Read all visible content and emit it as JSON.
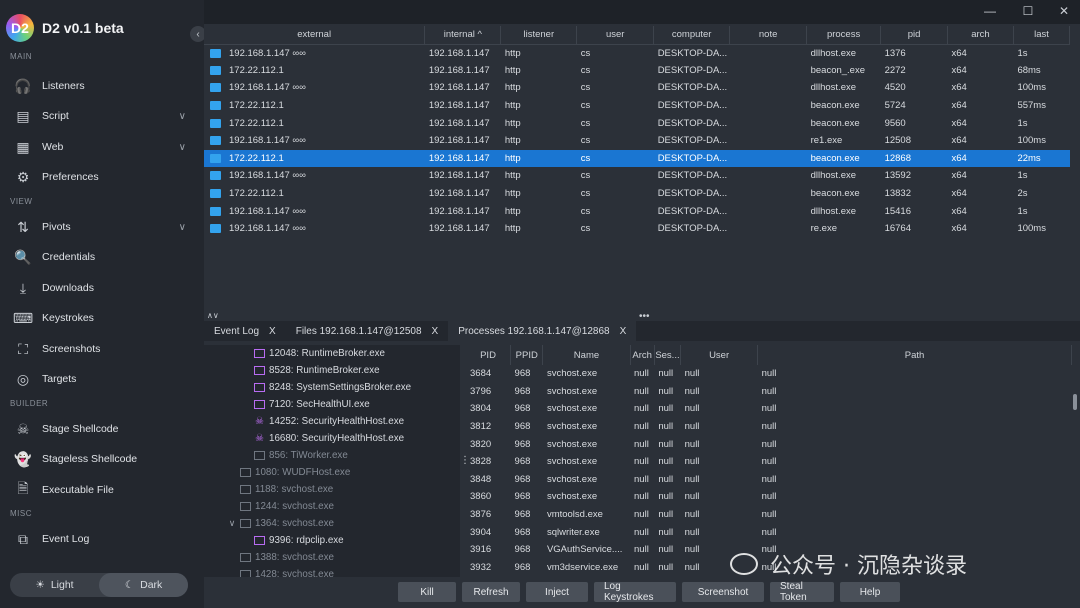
{
  "app": {
    "title": "D2 v0.1 beta",
    "logo_letter": "D2"
  },
  "window_controls": {
    "minimize": "—",
    "maximize": "☐",
    "close": "✕"
  },
  "sidebar": {
    "sections": [
      {
        "label": "MAIN",
        "items": [
          {
            "label": "Listeners",
            "icon": "headphones-icon",
            "glyph": "🎧"
          },
          {
            "label": "Script",
            "icon": "script-icon",
            "glyph": "▤",
            "chevron": true
          },
          {
            "label": "Web",
            "icon": "web-icon",
            "glyph": "▦",
            "chevron": true
          },
          {
            "label": "Preferences",
            "icon": "gear-icon",
            "glyph": "⚙"
          }
        ]
      },
      {
        "label": "VIEW",
        "items": [
          {
            "label": "Pivots",
            "icon": "pivot-icon",
            "glyph": "⇅",
            "chevron": true
          },
          {
            "label": "Credentials",
            "icon": "credentials-icon",
            "glyph": "🔍"
          },
          {
            "label": "Downloads",
            "icon": "download-icon",
            "glyph": "⤓"
          },
          {
            "label": "Keystrokes",
            "icon": "keyboard-icon",
            "glyph": "⌨"
          },
          {
            "label": "Screenshots",
            "icon": "screenshot-icon",
            "glyph": "⛶"
          },
          {
            "label": "Targets",
            "icon": "target-icon",
            "glyph": "◎"
          }
        ]
      },
      {
        "label": "BUILDER",
        "items": [
          {
            "label": "Stage Shellcode",
            "icon": "skull-icon",
            "glyph": "☠"
          },
          {
            "label": "Stageless Shellcode",
            "icon": "ghost-icon",
            "glyph": "👻"
          },
          {
            "label": "Executable File",
            "icon": "file-icon",
            "glyph": "🗎"
          }
        ]
      },
      {
        "label": "MISC",
        "items": [
          {
            "label": "Event Log",
            "icon": "event-log-icon",
            "glyph": "⧉"
          }
        ]
      }
    ],
    "theme": {
      "light": "Light",
      "dark": "Dark",
      "active": "Dark"
    }
  },
  "beacons": {
    "columns": [
      "external",
      "internal ^",
      "listener",
      "user",
      "computer",
      "note",
      "process",
      "pid",
      "arch",
      "last"
    ],
    "rows": [
      [
        "192.168.1.147 ∞∞",
        "192.168.1.147",
        "http",
        "cs",
        "DESKTOP-DA...",
        "",
        "dllhost.exe",
        "1376",
        "x64",
        "1s"
      ],
      [
        "172.22.112.1",
        "192.168.1.147",
        "http",
        "cs",
        "DESKTOP-DA...",
        "",
        "beacon_.exe",
        "2272",
        "x64",
        "68ms"
      ],
      [
        "192.168.1.147 ∞∞",
        "192.168.1.147",
        "http",
        "cs",
        "DESKTOP-DA...",
        "",
        "dllhost.exe",
        "4520",
        "x64",
        "100ms"
      ],
      [
        "172.22.112.1",
        "192.168.1.147",
        "http",
        "cs",
        "DESKTOP-DA...",
        "",
        "beacon.exe",
        "5724",
        "x64",
        "557ms"
      ],
      [
        "172.22.112.1",
        "192.168.1.147",
        "http",
        "cs",
        "DESKTOP-DA...",
        "",
        "beacon.exe",
        "9560",
        "x64",
        "1s"
      ],
      [
        "192.168.1.147 ∞∞",
        "192.168.1.147",
        "http",
        "cs",
        "DESKTOP-DA...",
        "",
        "re1.exe",
        "12508",
        "x64",
        "100ms"
      ],
      [
        "172.22.112.1",
        "192.168.1.147",
        "http",
        "cs",
        "DESKTOP-DA...",
        "",
        "beacon.exe",
        "12868",
        "x64",
        "22ms"
      ],
      [
        "192.168.1.147 ∞∞",
        "192.168.1.147",
        "http",
        "cs",
        "DESKTOP-DA...",
        "",
        "dllhost.exe",
        "13592",
        "x64",
        "1s"
      ],
      [
        "172.22.112.1",
        "192.168.1.147",
        "http",
        "cs",
        "DESKTOP-DA...",
        "",
        "beacon.exe",
        "13832",
        "x64",
        "2s"
      ],
      [
        "192.168.1.147 ∞∞",
        "192.168.1.147",
        "http",
        "cs",
        "DESKTOP-DA...",
        "",
        "dllhost.exe",
        "15416",
        "x64",
        "1s"
      ],
      [
        "192.168.1.147 ∞∞",
        "192.168.1.147",
        "http",
        "cs",
        "DESKTOP-DA...",
        "",
        "re.exe",
        "16764",
        "x64",
        "100ms"
      ]
    ],
    "selected_index": 6
  },
  "tabs": [
    {
      "label": "Event Log",
      "close": "X",
      "active": false
    },
    {
      "label": "Files 192.168.1.147@12508",
      "close": "X",
      "active": false
    },
    {
      "label": "Processes 192.168.1.147@12868",
      "close": "X",
      "active": true
    }
  ],
  "tree": [
    {
      "label": "12048: RuntimeBroker.exe",
      "indent": 50,
      "type": "proc"
    },
    {
      "label": "8528: RuntimeBroker.exe",
      "indent": 50,
      "type": "proc"
    },
    {
      "label": "8248: SystemSettingsBroker.exe",
      "indent": 50,
      "type": "proc"
    },
    {
      "label": "7120: SecHealthUI.exe",
      "indent": 50,
      "type": "proc"
    },
    {
      "label": "14252: SecurityHealthHost.exe",
      "indent": 50,
      "type": "skull"
    },
    {
      "label": "16680: SecurityHealthHost.exe",
      "indent": 50,
      "type": "skull"
    },
    {
      "label": "856: TiWorker.exe",
      "indent": 50,
      "type": "dim"
    },
    {
      "label": "1080: WUDFHost.exe",
      "indent": 36,
      "type": "dim"
    },
    {
      "label": "1188: svchost.exe",
      "indent": 36,
      "type": "dim"
    },
    {
      "label": "1244: svchost.exe",
      "indent": 36,
      "type": "dim"
    },
    {
      "label": "1364: svchost.exe",
      "indent": 22,
      "type": "dim",
      "twisty": "∨"
    },
    {
      "label": "9396: rdpclip.exe",
      "indent": 50,
      "type": "proc"
    },
    {
      "label": "1388: svchost.exe",
      "indent": 36,
      "type": "dim"
    },
    {
      "label": "1428: svchost.exe",
      "indent": 36,
      "type": "dim"
    }
  ],
  "processes": {
    "columns": [
      "PID",
      "PPID",
      "Name",
      "Arch",
      "Ses...",
      "User",
      "Path"
    ],
    "rows": [
      [
        "3684",
        "968",
        "svchost.exe",
        "null",
        "null",
        "null",
        "null"
      ],
      [
        "3796",
        "968",
        "svchost.exe",
        "null",
        "null",
        "null",
        "null"
      ],
      [
        "3804",
        "968",
        "svchost.exe",
        "null",
        "null",
        "null",
        "null"
      ],
      [
        "3812",
        "968",
        "svchost.exe",
        "null",
        "null",
        "null",
        "null"
      ],
      [
        "3820",
        "968",
        "svchost.exe",
        "null",
        "null",
        "null",
        "null"
      ],
      [
        "3828",
        "968",
        "svchost.exe",
        "null",
        "null",
        "null",
        "null"
      ],
      [
        "3848",
        "968",
        "svchost.exe",
        "null",
        "null",
        "null",
        "null"
      ],
      [
        "3860",
        "968",
        "svchost.exe",
        "null",
        "null",
        "null",
        "null"
      ],
      [
        "3876",
        "968",
        "vmtoolsd.exe",
        "null",
        "null",
        "null",
        "null"
      ],
      [
        "3904",
        "968",
        "sqlwriter.exe",
        "null",
        "null",
        "null",
        "null"
      ],
      [
        "3916",
        "968",
        "VGAuthService....",
        "null",
        "null",
        "null",
        "null"
      ],
      [
        "3932",
        "968",
        "vm3dservice.exe",
        "null",
        "null",
        "null",
        "null"
      ]
    ]
  },
  "actions": [
    "Kill",
    "Refresh",
    "Inject",
    "Log Keystrokes",
    "Screenshot",
    "Steal Token",
    "Help"
  ],
  "watermark": "公众号 · 沉隐杂谈录"
}
